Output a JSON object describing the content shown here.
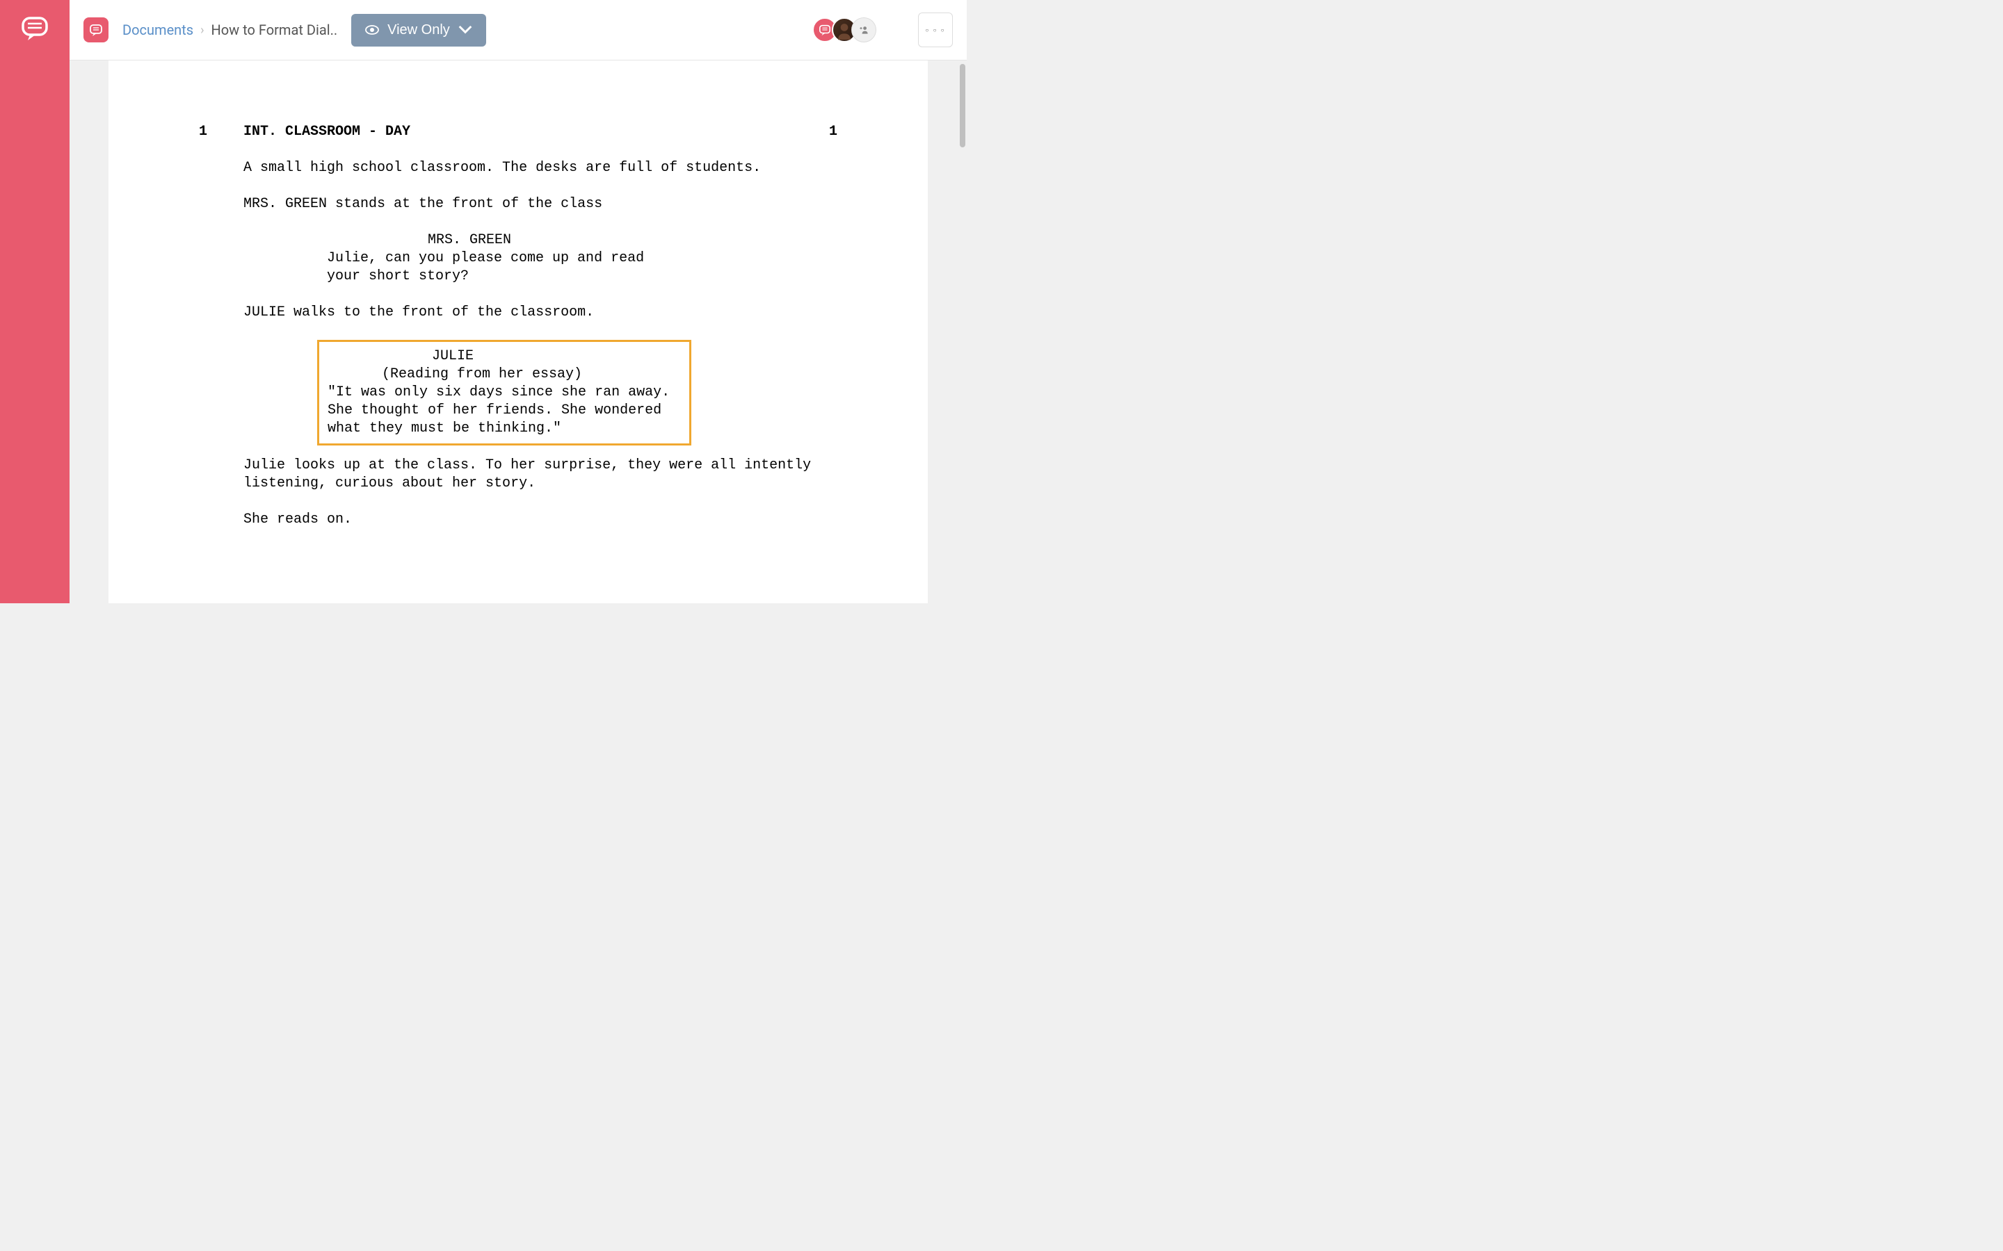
{
  "header": {
    "breadcrumb": {
      "documents_label": "Documents",
      "current_doc": "How to Format Dial.."
    },
    "view_button": "View Only"
  },
  "screenplay": {
    "scene_number_left": "1",
    "scene_number_right": "1",
    "scene_heading": "INT. CLASSROOM - DAY",
    "action1": "A small high school classroom. The desks are full of students.",
    "action2": "MRS. GREEN stands at the front of the class",
    "dialogue1": {
      "character": "MRS. GREEN",
      "line": "Julie, can you please come up and read your short story?"
    },
    "action3": "JULIE walks to the front of the classroom.",
    "dialogue2": {
      "character": "JULIE",
      "parenthetical": "(Reading from her essay)",
      "line": "\"It was only six days since she ran away. She thought of her friends. She wondered what they must be thinking.\""
    },
    "action4": "Julie looks up at the class. To her surprise, they were all intently listening, curious about her story.",
    "action5": "She reads on."
  }
}
